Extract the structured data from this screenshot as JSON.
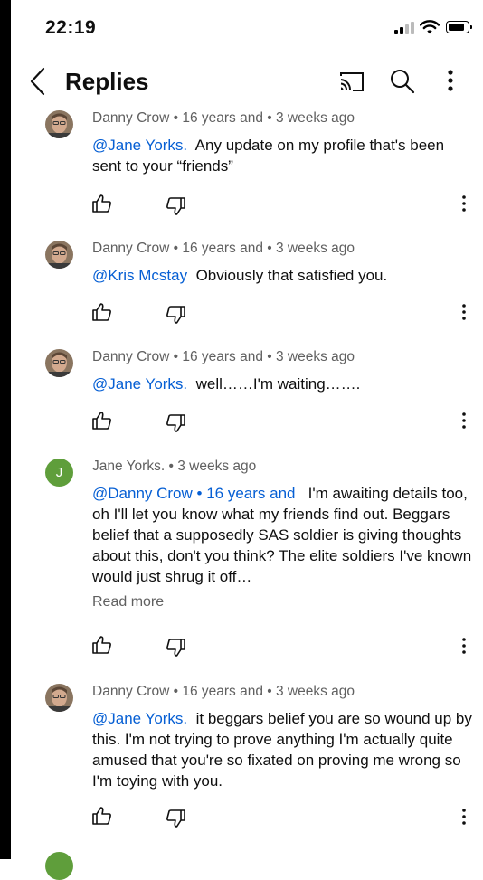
{
  "status_bar": {
    "time": "22:19"
  },
  "header": {
    "title": "Replies"
  },
  "comments": [
    {
      "author": "Danny Crow",
      "author_suffix": "16 years and",
      "time": "3 weeks ago",
      "mention": "@Jane Yorks.",
      "text": "Any update on my profile that's been sent to your “friends”",
      "avatar_type": "photo"
    },
    {
      "author": "Danny Crow",
      "author_suffix": "16 years and",
      "time": "3 weeks ago",
      "mention": "@Kris Mcstay",
      "text": "Obviously that satisfied you.",
      "avatar_type": "photo"
    },
    {
      "author": "Danny Crow",
      "author_suffix": "16 years and",
      "time": "3 weeks ago",
      "mention": "@Jane Yorks.",
      "text": "well……I'm waiting…….",
      "avatar_type": "photo"
    },
    {
      "author": "Jane Yorks.",
      "time": "3 weeks ago",
      "mention": "@Danny Crow • 16 years and",
      "text": "I'm awaiting details too, oh I'll let you know what my friends find out. Beggars belief that a supposedly SAS soldier is giving thoughts about this, don't you think?  The elite soldiers I've known would just shrug it off…",
      "read_more": "Read more",
      "avatar_type": "letter",
      "avatar_letter": "J",
      "avatar_color": "#5f9e3b"
    },
    {
      "author": "Danny Crow",
      "author_suffix": "16 years and",
      "time": "3 weeks ago",
      "mention": "@Jane Yorks.",
      "text": "it beggars belief you are so wound up by this. I'm not trying to prove anything I'm actually quite amused that you're so fixated on proving me wrong so I'm toying with you.",
      "avatar_type": "photo"
    }
  ],
  "icons": {
    "back": "chevron-left-icon",
    "cast": "cast-icon",
    "search": "search-icon",
    "more": "more-vertical-icon",
    "like": "thumbs-up-icon",
    "dislike": "thumbs-down-icon"
  },
  "colors": {
    "mention": "#065fd4",
    "meta": "#606060",
    "avatar_j": "#5f9e3b"
  }
}
